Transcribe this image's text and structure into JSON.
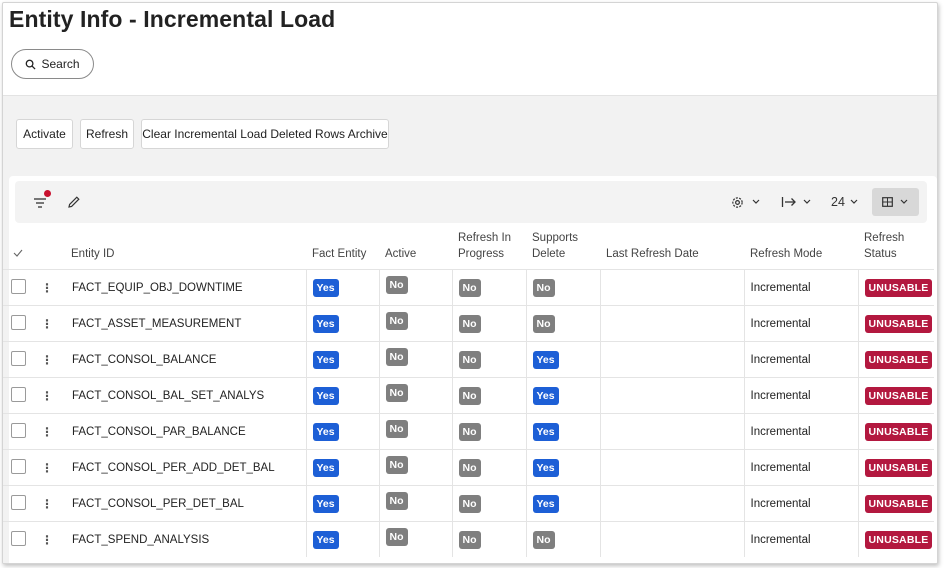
{
  "page": {
    "title": "Entity Info - Incremental Load"
  },
  "search": {
    "label": "Search"
  },
  "actions": {
    "activate": "Activate",
    "refresh": "Refresh",
    "clear": "Clear Incremental Load Deleted Rows Archive"
  },
  "toolbar": {
    "page_size": "24",
    "filter_active_color": "#c8102e"
  },
  "table": {
    "columns": {
      "entity_id": "Entity ID",
      "fact_entity": "Fact Entity",
      "active": "Active",
      "refresh_in_progress_1": "Refresh In",
      "refresh_in_progress_2": "Progress",
      "supports_delete_1": "Supports",
      "supports_delete_2": "Delete",
      "last_refresh_date": "Last Refresh Date",
      "refresh_mode": "Refresh Mode",
      "refresh_status_1": "Refresh",
      "refresh_status_2": "Status"
    },
    "rows": [
      {
        "entity_id": "FACT_EQUIP_OBJ_DOWNTIME",
        "fact_entity": "Yes",
        "active": "No",
        "refresh_in_progress": "No",
        "supports_delete": "No",
        "last_refresh_date": "",
        "refresh_mode": "Incremental",
        "refresh_status": "UNUSABLE"
      },
      {
        "entity_id": "FACT_ASSET_MEASUREMENT",
        "fact_entity": "Yes",
        "active": "No",
        "refresh_in_progress": "No",
        "supports_delete": "No",
        "last_refresh_date": "",
        "refresh_mode": "Incremental",
        "refresh_status": "UNUSABLE"
      },
      {
        "entity_id": "FACT_CONSOL_BALANCE",
        "fact_entity": "Yes",
        "active": "No",
        "refresh_in_progress": "No",
        "supports_delete": "Yes",
        "last_refresh_date": "",
        "refresh_mode": "Incremental",
        "refresh_status": "UNUSABLE"
      },
      {
        "entity_id": "FACT_CONSOL_BAL_SET_ANALYS",
        "fact_entity": "Yes",
        "active": "No",
        "refresh_in_progress": "No",
        "supports_delete": "Yes",
        "last_refresh_date": "",
        "refresh_mode": "Incremental",
        "refresh_status": "UNUSABLE"
      },
      {
        "entity_id": "FACT_CONSOL_PAR_BALANCE",
        "fact_entity": "Yes",
        "active": "No",
        "refresh_in_progress": "No",
        "supports_delete": "Yes",
        "last_refresh_date": "",
        "refresh_mode": "Incremental",
        "refresh_status": "UNUSABLE"
      },
      {
        "entity_id": "FACT_CONSOL_PER_ADD_DET_BAL",
        "fact_entity": "Yes",
        "active": "No",
        "refresh_in_progress": "No",
        "supports_delete": "Yes",
        "last_refresh_date": "",
        "refresh_mode": "Incremental",
        "refresh_status": "UNUSABLE"
      },
      {
        "entity_id": "FACT_CONSOL_PER_DET_BAL",
        "fact_entity": "Yes",
        "active": "No",
        "refresh_in_progress": "No",
        "supports_delete": "Yes",
        "last_refresh_date": "",
        "refresh_mode": "Incremental",
        "refresh_status": "UNUSABLE"
      },
      {
        "entity_id": "FACT_SPEND_ANALYSIS",
        "fact_entity": "Yes",
        "active": "No",
        "refresh_in_progress": "No",
        "supports_delete": "No",
        "last_refresh_date": "",
        "refresh_mode": "Incremental",
        "refresh_status": "UNUSABLE"
      }
    ]
  }
}
